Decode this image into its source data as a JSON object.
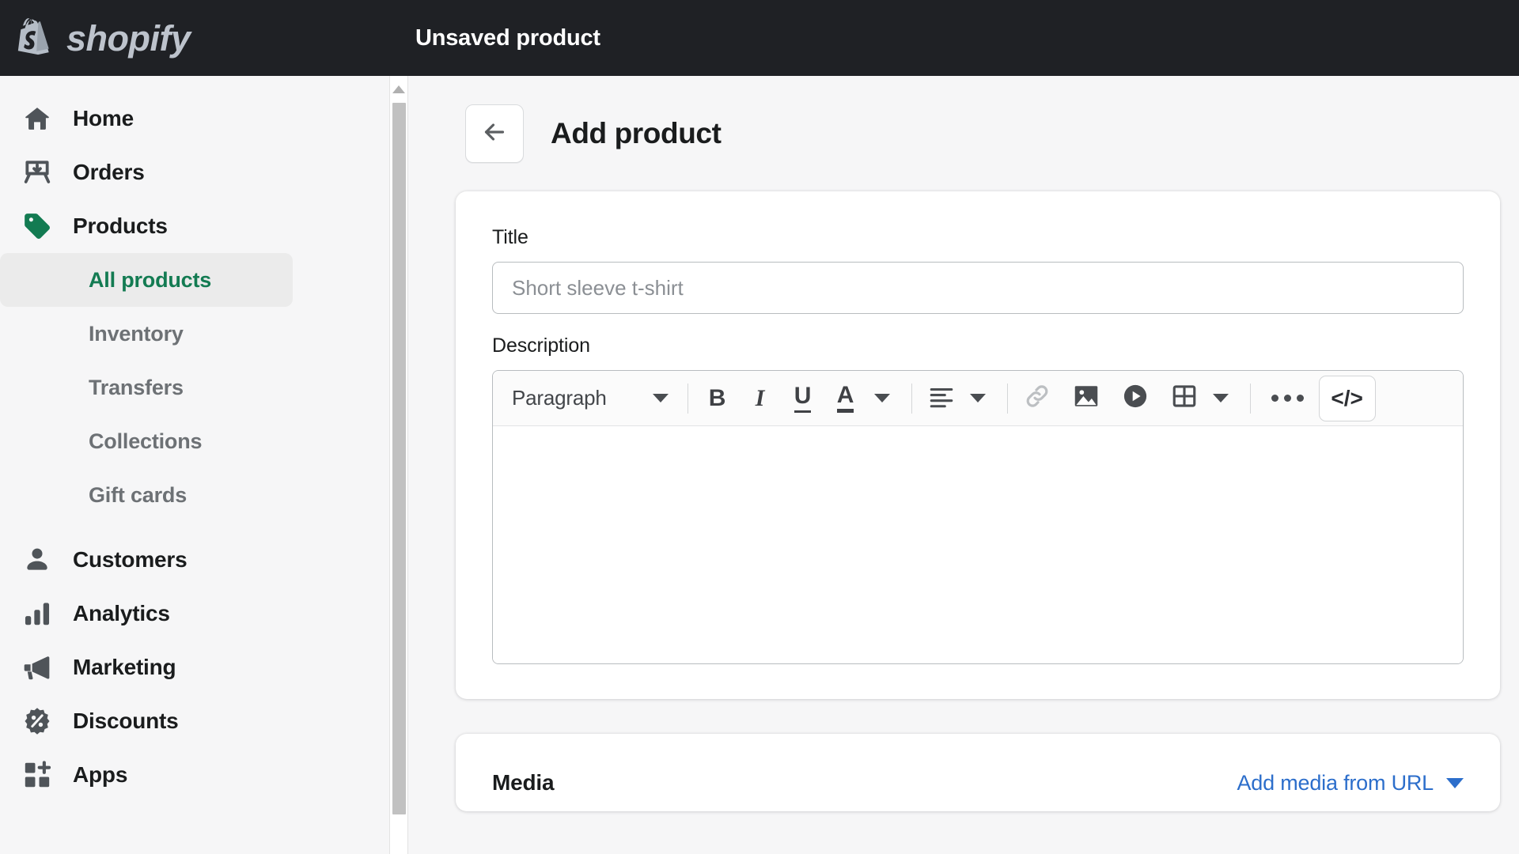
{
  "topbar": {
    "brand_name": "shopify",
    "logo_icon": "shopify-bag-icon",
    "title": "Unsaved product"
  },
  "sidebar": {
    "items": [
      {
        "label": "Home",
        "icon": "home-icon",
        "active": false
      },
      {
        "label": "Orders",
        "icon": "orders-inbox-icon",
        "active": false
      },
      {
        "label": "Products",
        "icon": "product-tag-icon",
        "active": true
      }
    ],
    "sub_items": [
      {
        "label": "All products",
        "active": true
      },
      {
        "label": "Inventory",
        "active": false
      },
      {
        "label": "Transfers",
        "active": false
      },
      {
        "label": "Collections",
        "active": false
      },
      {
        "label": "Gift cards",
        "active": false
      }
    ],
    "items_lower": [
      {
        "label": "Customers",
        "icon": "customer-person-icon"
      },
      {
        "label": "Analytics",
        "icon": "analytics-bars-icon"
      },
      {
        "label": "Marketing",
        "icon": "marketing-megaphone-icon"
      },
      {
        "label": "Discounts",
        "icon": "discount-percent-badge-icon"
      },
      {
        "label": "Apps",
        "icon": "apps-grid-plus-icon"
      }
    ]
  },
  "page": {
    "back_icon": "arrow-left-icon",
    "title": "Add product"
  },
  "product_card": {
    "title_label": "Title",
    "title_value": "",
    "title_placeholder": "Short sleeve t-shirt",
    "description_label": "Description"
  },
  "editor_toolbar": {
    "style_select": "Paragraph",
    "buttons": [
      {
        "name": "bold-button",
        "glyph": "B"
      },
      {
        "name": "italic-button",
        "glyph": "I"
      },
      {
        "name": "underline-button",
        "glyph": "U"
      },
      {
        "name": "text-color-button",
        "glyph": "A"
      },
      {
        "name": "align-button",
        "glyph": "align-left-icon"
      },
      {
        "name": "link-button",
        "glyph": "link-icon"
      },
      {
        "name": "image-button",
        "glyph": "image-icon"
      },
      {
        "name": "video-button",
        "glyph": "video-play-icon"
      },
      {
        "name": "table-button",
        "glyph": "table-icon"
      },
      {
        "name": "more-button",
        "glyph": "ellipsis-icon"
      },
      {
        "name": "code-button",
        "glyph": "</>"
      }
    ],
    "code_label": "</>"
  },
  "media_card": {
    "title": "Media",
    "add_from_url_label": "Add media from URL"
  },
  "colors": {
    "topbar_bg": "#1f2125",
    "accent_green": "#137b52",
    "link_blue": "#2c6ecb",
    "page_bg": "#f6f6f7"
  }
}
